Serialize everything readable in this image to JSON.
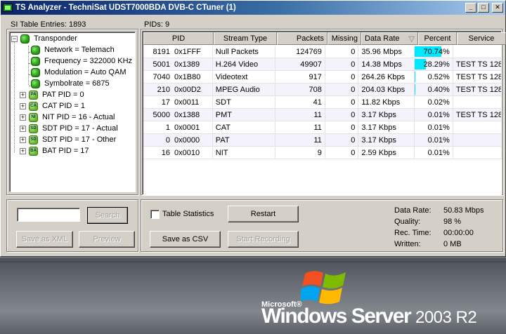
{
  "window": {
    "title": "TS Analyzer - TechniSat UDST7000BDA DVB-C CTuner (1)"
  },
  "si_table": {
    "label": "SI Table Entries: 1893",
    "root": "Transponder",
    "details": [
      "Network = Telemach",
      "Frequency = 322000 KHz",
      "Modulation = Auto QAM",
      "Symbolrate = 6875"
    ],
    "tables": [
      {
        "label": "PAT PID = 0",
        "icon": "PA"
      },
      {
        "label": "CAT PID = 1",
        "icon": "CA"
      },
      {
        "label": "NIT PID = 16 - Actual",
        "icon": "NI"
      },
      {
        "label": "SDT PID = 17 - Actual",
        "icon": "SD"
      },
      {
        "label": "SDT PID = 17 - Other",
        "icon": "SD"
      },
      {
        "label": "BAT PID = 17",
        "icon": "BA"
      }
    ],
    "search_button": "Search",
    "save_xml_button": "Save as XML",
    "preview_button": "Preview"
  },
  "pids": {
    "label": "PIDs: 9",
    "columns": [
      "PID",
      "Stream Type",
      "Packets",
      "Missing",
      "Data Rate",
      "Percent",
      "Service"
    ],
    "sort_indicator": "▽",
    "rows": [
      {
        "pid_dec": "8191",
        "pid_hex": "0x1FFF",
        "type": "Null Packets",
        "packets": "124769",
        "missing": "0",
        "rate": "35.96 Mbps",
        "percent": "70.74%",
        "pct": 0.7074,
        "service": ""
      },
      {
        "pid_dec": "5001",
        "pid_hex": "0x1389",
        "type": "H.264 Video",
        "packets": "49907",
        "missing": "0",
        "rate": "14.38 Mbps",
        "percent": "28.29%",
        "pct": 0.2829,
        "service": "TEST TS 128"
      },
      {
        "pid_dec": "7040",
        "pid_hex": "0x1B80",
        "type": "Videotext",
        "packets": "917",
        "missing": "0",
        "rate": "264.26 Kbps",
        "percent": "0.52%",
        "pct": 0.0052,
        "service": "TEST TS 128"
      },
      {
        "pid_dec": "210",
        "pid_hex": "0x00D2",
        "type": "MPEG Audio",
        "packets": "708",
        "missing": "0",
        "rate": "204.03 Kbps",
        "percent": "0.40%",
        "pct": 0.004,
        "service": "TEST TS 128"
      },
      {
        "pid_dec": "17",
        "pid_hex": "0x0011",
        "type": "SDT",
        "packets": "41",
        "missing": "0",
        "rate": "11.82 Kbps",
        "percent": "0.02%",
        "pct": 0.0002,
        "service": ""
      },
      {
        "pid_dec": "5000",
        "pid_hex": "0x1388",
        "type": "PMT",
        "packets": "11",
        "missing": "0",
        "rate": "3.17 Kbps",
        "percent": "0.01%",
        "pct": 0.0001,
        "service": "TEST TS 128"
      },
      {
        "pid_dec": "1",
        "pid_hex": "0x0001",
        "type": "CAT",
        "packets": "11",
        "missing": "0",
        "rate": "3.17 Kbps",
        "percent": "0.01%",
        "pct": 0.0001,
        "service": ""
      },
      {
        "pid_dec": "0",
        "pid_hex": "0x0000",
        "type": "PAT",
        "packets": "11",
        "missing": "0",
        "rate": "3.17 Kbps",
        "percent": "0.01%",
        "pct": 0.0001,
        "service": ""
      },
      {
        "pid_dec": "16",
        "pid_hex": "0x0010",
        "type": "NIT",
        "packets": "9",
        "missing": "0",
        "rate": "2.59 Kbps",
        "percent": "0.01%",
        "pct": 0.0001,
        "service": ""
      }
    ]
  },
  "controls": {
    "table_statistics": "Table Statistics",
    "restart": "Restart",
    "save_csv": "Save as CSV",
    "start_recording": "Start Recording"
  },
  "stats": [
    {
      "key": "Data Rate:",
      "value": "50.83 Mbps"
    },
    {
      "key": "Quality:",
      "value": "98 %"
    },
    {
      "key": "Rec. Time:",
      "value": "00:00:00"
    },
    {
      "key": "Written:",
      "value": "0 MB"
    }
  ],
  "desktop": {
    "ms_label": "Microsoft®",
    "product": "Windows Server",
    "version": "2003 R2"
  },
  "colors": {
    "percent_bar": "#00e8ff",
    "title_start": "#0a246a",
    "title_end": "#a6caf0"
  }
}
